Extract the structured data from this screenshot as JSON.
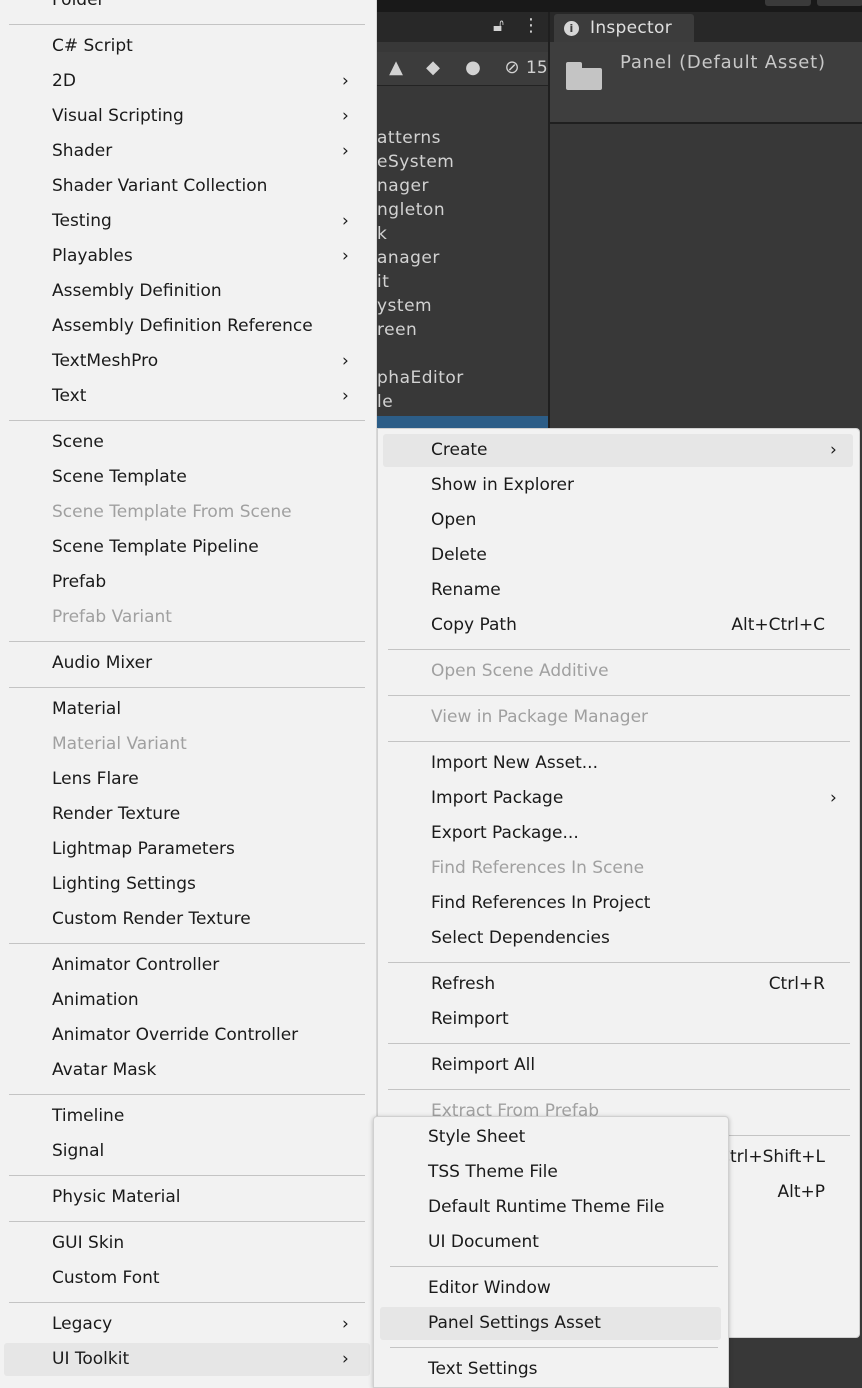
{
  "project_panel": {
    "hidden_count": "15",
    "folders": [
      "atterns",
      "eSystem",
      "nager",
      "ngleton",
      "k",
      "anager",
      "it",
      "ystem",
      "reen",
      "",
      "phaEditor",
      "le"
    ]
  },
  "inspector": {
    "tab_label": "Inspector",
    "title": "Panel (Default Asset)"
  },
  "create_menu": {
    "items": [
      {
        "label": "Folder"
      },
      {
        "label": "C# Script"
      },
      {
        "label": "2D",
        "submenu": true
      },
      {
        "label": "Visual Scripting",
        "submenu": true
      },
      {
        "label": "Shader",
        "submenu": true
      },
      {
        "label": "Shader Variant Collection"
      },
      {
        "label": "Testing",
        "submenu": true
      },
      {
        "label": "Playables",
        "submenu": true
      },
      {
        "label": "Assembly Definition"
      },
      {
        "label": "Assembly Definition Reference"
      },
      {
        "label": "TextMeshPro",
        "submenu": true
      },
      {
        "label": "Text",
        "submenu": true
      },
      {
        "label": "Scene"
      },
      {
        "label": "Scene Template"
      },
      {
        "label": "Scene Template From Scene",
        "disabled": true
      },
      {
        "label": "Scene Template Pipeline"
      },
      {
        "label": "Prefab"
      },
      {
        "label": "Prefab Variant",
        "disabled": true
      },
      {
        "label": "Audio Mixer"
      },
      {
        "label": "Material"
      },
      {
        "label": "Material Variant",
        "disabled": true
      },
      {
        "label": "Lens Flare"
      },
      {
        "label": "Render Texture"
      },
      {
        "label": "Lightmap Parameters"
      },
      {
        "label": "Lighting Settings"
      },
      {
        "label": "Custom Render Texture"
      },
      {
        "label": "Animator Controller"
      },
      {
        "label": "Animation"
      },
      {
        "label": "Animator Override Controller"
      },
      {
        "label": "Avatar Mask"
      },
      {
        "label": "Timeline"
      },
      {
        "label": "Signal"
      },
      {
        "label": "Physic Material"
      },
      {
        "label": "GUI Skin"
      },
      {
        "label": "Custom Font"
      },
      {
        "label": "Legacy",
        "submenu": true
      },
      {
        "label": "UI Toolkit",
        "submenu": true,
        "hover": true
      }
    ]
  },
  "context_menu": {
    "items": [
      {
        "label": "Create",
        "submenu": true,
        "hover": true
      },
      {
        "label": "Show in Explorer"
      },
      {
        "label": "Open"
      },
      {
        "label": "Delete"
      },
      {
        "label": "Rename"
      },
      {
        "label": "Copy Path",
        "shortcut": "Alt+Ctrl+C"
      },
      {
        "label": "Open Scene Additive",
        "disabled": true
      },
      {
        "label": "View in Package Manager",
        "disabled": true
      },
      {
        "label": "Import New Asset..."
      },
      {
        "label": "Import Package",
        "submenu": true
      },
      {
        "label": "Export Package..."
      },
      {
        "label": "Find References In Scene",
        "disabled": true
      },
      {
        "label": "Find References In Project"
      },
      {
        "label": "Select Dependencies"
      },
      {
        "label": "Refresh",
        "shortcut": "Ctrl+R"
      },
      {
        "label": "Reimport"
      },
      {
        "label": "Reimport All"
      },
      {
        "label": "Extract From Prefab",
        "disabled": true
      },
      {
        "label": "",
        "shortcut": "Ctrl+Shift+L"
      },
      {
        "label": "",
        "shortcut": "Alt+P"
      }
    ]
  },
  "ui_toolkit_menu": {
    "items": [
      {
        "label": "Style Sheet"
      },
      {
        "label": "TSS Theme File"
      },
      {
        "label": "Default Runtime Theme File"
      },
      {
        "label": "UI Document"
      },
      {
        "label": "Editor Window"
      },
      {
        "label": "Panel Settings Asset",
        "hover": true
      },
      {
        "label": "Text Settings"
      }
    ]
  },
  "colors": {
    "menu_background": "#f2f2f2",
    "menu_text": "#1a1a1a",
    "menu_disabled_text": "#a0a0a0",
    "menu_hover": "#e6e6e6",
    "editor_panel": "#383838",
    "selection": "#2c5d87"
  }
}
